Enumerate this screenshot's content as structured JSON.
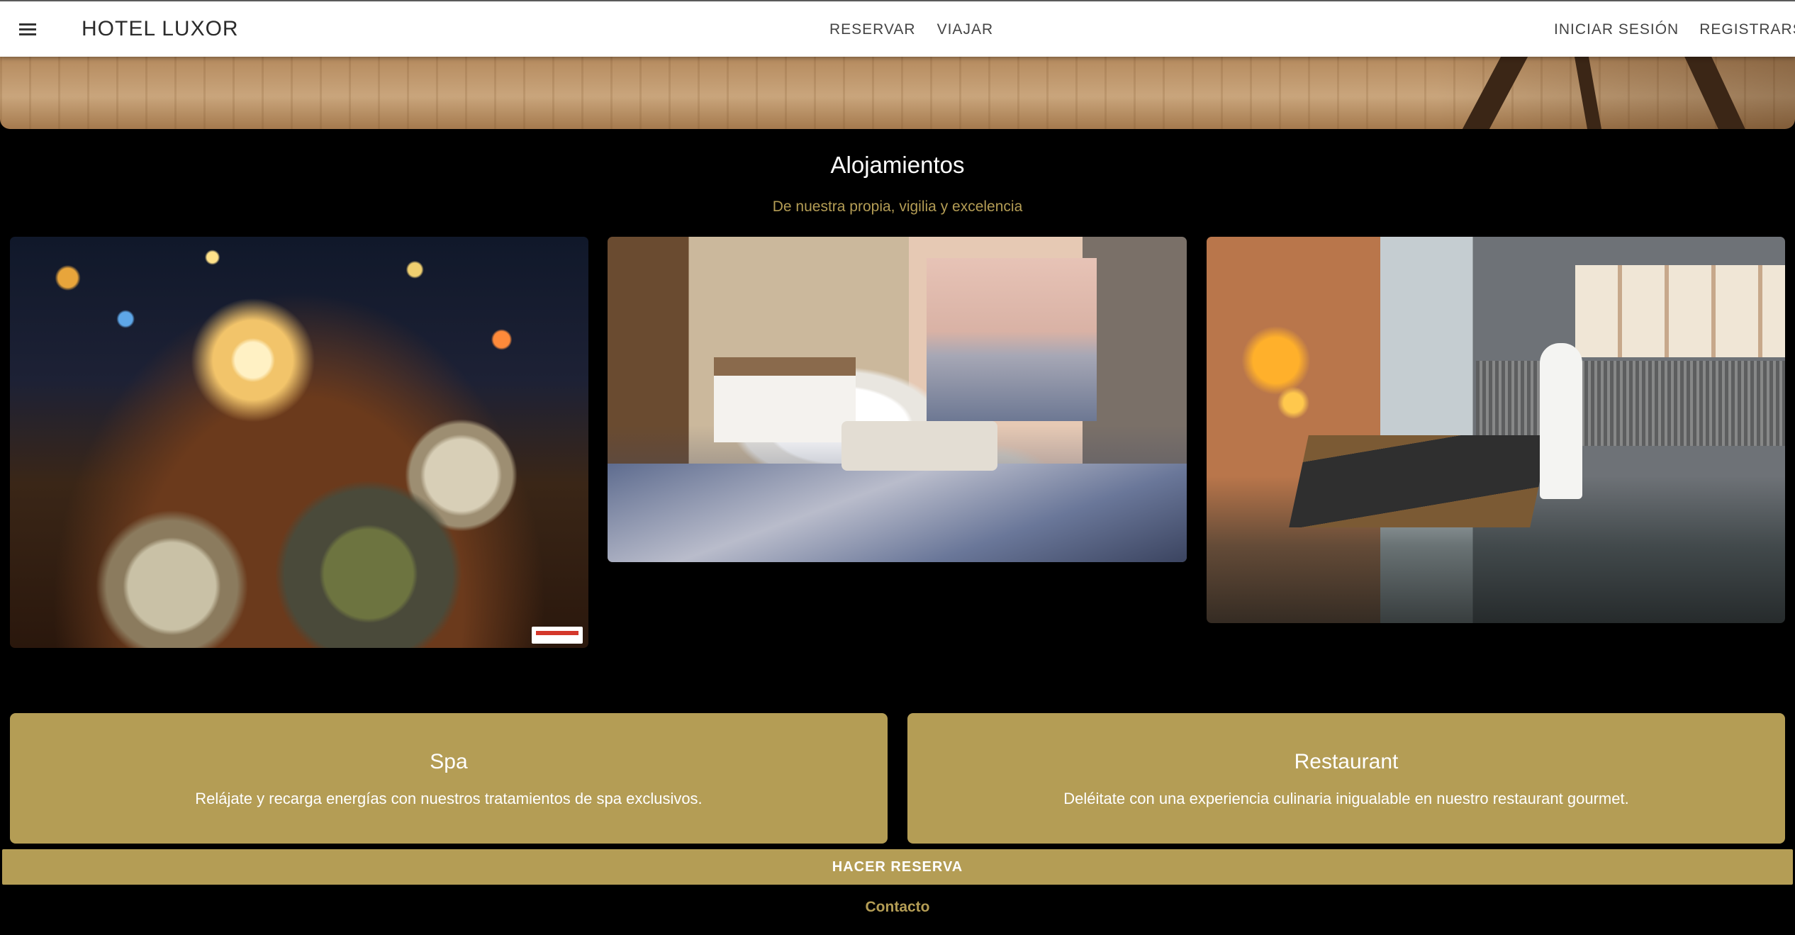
{
  "header": {
    "brand": "HOTEL LUXOR",
    "nav_center": [
      "RESERVAR",
      "VIAJAR"
    ],
    "nav_right": [
      "INICIAR SESIÓN",
      "REGISTRARSE"
    ],
    "menu_icon": "hamburger-menu-icon"
  },
  "section": {
    "title": "Alojamientos",
    "subtitle": "De nuestra propia, vigilia y excelencia"
  },
  "gallery": [
    {
      "subject": "restaurant-table-night-city"
    },
    {
      "subject": "hotel-suite-bedroom"
    },
    {
      "subject": "spa-relaxation-area"
    }
  ],
  "features": [
    {
      "title": "Spa",
      "text": "Relájate y recarga energías con nuestros tratamientos de spa exclusivos."
    },
    {
      "title": "Restaurant",
      "text": "Deléitate con una experiencia culinaria inigualable en nuestro restaurant gourmet."
    }
  ],
  "footer": {
    "reserve_label": "HACER RESERVA",
    "contact_label": "Contacto"
  },
  "colors": {
    "accent": "#b49d55",
    "background": "#000000",
    "header_bg": "#ffffff"
  }
}
